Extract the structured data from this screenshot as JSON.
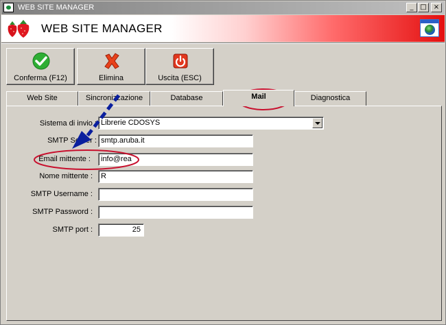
{
  "window": {
    "title": "WEB SITE MANAGER",
    "controls": [
      "_",
      "□",
      "×"
    ]
  },
  "banner": {
    "title": "WEB SITE MANAGER",
    "logo_icon": "strawberry-logo-icon",
    "right_icon": "globe-window-icon"
  },
  "toolbar": {
    "buttons": [
      {
        "label": "Conferma (F12)",
        "icon": "green-check-icon"
      },
      {
        "label": "Elimina",
        "icon": "red-x-icon"
      },
      {
        "label": "Uscita (ESC)",
        "icon": "power-exit-icon"
      }
    ]
  },
  "tabs": [
    {
      "label": "Web Site"
    },
    {
      "label": "Sincronizzazione"
    },
    {
      "label": "Database"
    },
    {
      "label": "Mail",
      "active": true
    },
    {
      "label": "Diagnostica"
    }
  ],
  "mail_form": {
    "sistema_invio": {
      "label": "Sistema di invio :",
      "value": "Librerie CDOSYS"
    },
    "smtp_server": {
      "label": "SMTP Server :",
      "value": "smtp.aruba.it"
    },
    "email_mittente": {
      "label": "Email mittente :",
      "value": "info@rea"
    },
    "nome_mittente": {
      "label": "Nome mittente :",
      "value": "R"
    },
    "smtp_username": {
      "label": "SMTP Username :",
      "value": ""
    },
    "smtp_password": {
      "label": "SMTP Password :",
      "value": ""
    },
    "smtp_port": {
      "label": "SMTP port :",
      "value": "25"
    }
  },
  "annotations": {
    "highlight_color": "#c8102e",
    "arrow_color": "#0a1f9e"
  },
  "colors": {
    "window_bg": "#d4d0c8",
    "banner_accent": "#e41010"
  }
}
